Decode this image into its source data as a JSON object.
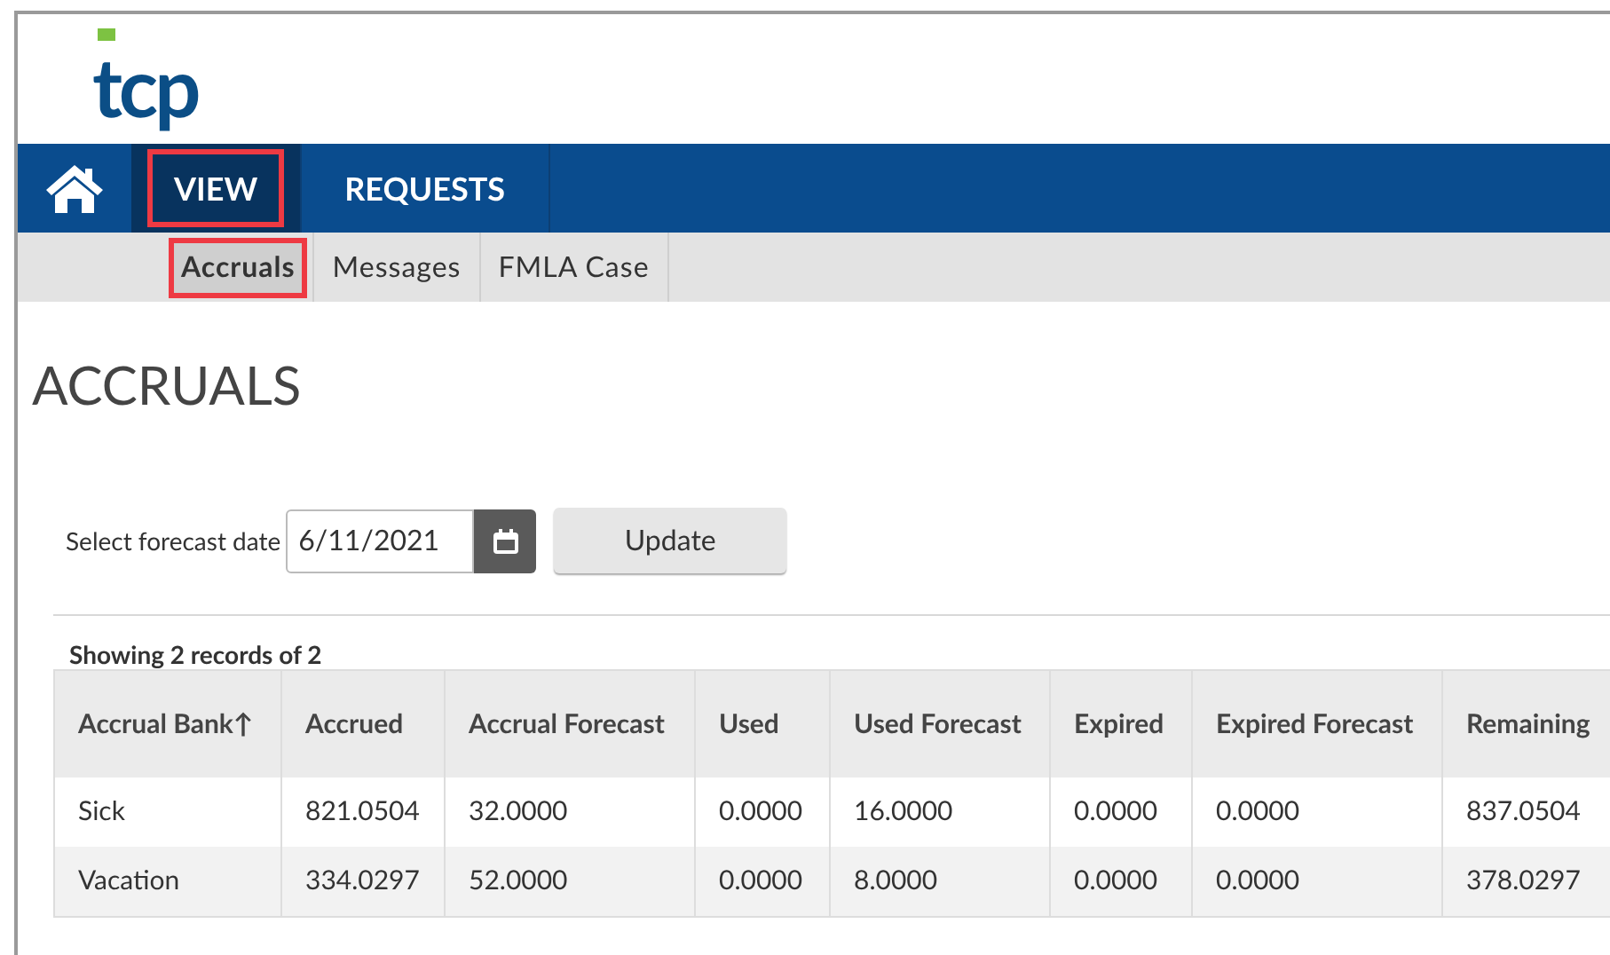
{
  "logo": {
    "text": "tcp"
  },
  "nav": {
    "items": [
      {
        "label": "VIEW",
        "selected": true
      },
      {
        "label": "REQUESTS",
        "selected": false
      }
    ]
  },
  "subnav": {
    "items": [
      {
        "label": "Accruals",
        "selected": true
      },
      {
        "label": "Messages",
        "selected": false
      },
      {
        "label": "FMLA Case",
        "selected": false
      }
    ]
  },
  "page_title": "ACCRUALS",
  "forecast": {
    "label": "Select forecast date",
    "value": "6/11/2021",
    "button": "Update"
  },
  "records_summary": "Showing 2 records of 2",
  "table": {
    "columns": [
      "Accrual Bank↑",
      "Accrued",
      "Accrual Forecast",
      "Used",
      "Used Forecast",
      "Expired",
      "Expired Forecast",
      "Remaining"
    ],
    "rows": [
      [
        "Sick",
        "821.0504",
        "32.0000",
        "0.0000",
        "16.0000",
        "0.0000",
        "0.0000",
        "837.0504"
      ],
      [
        "Vacation",
        "334.0297",
        "52.0000",
        "0.0000",
        "8.0000",
        "0.0000",
        "0.0000",
        "378.0297"
      ]
    ]
  }
}
